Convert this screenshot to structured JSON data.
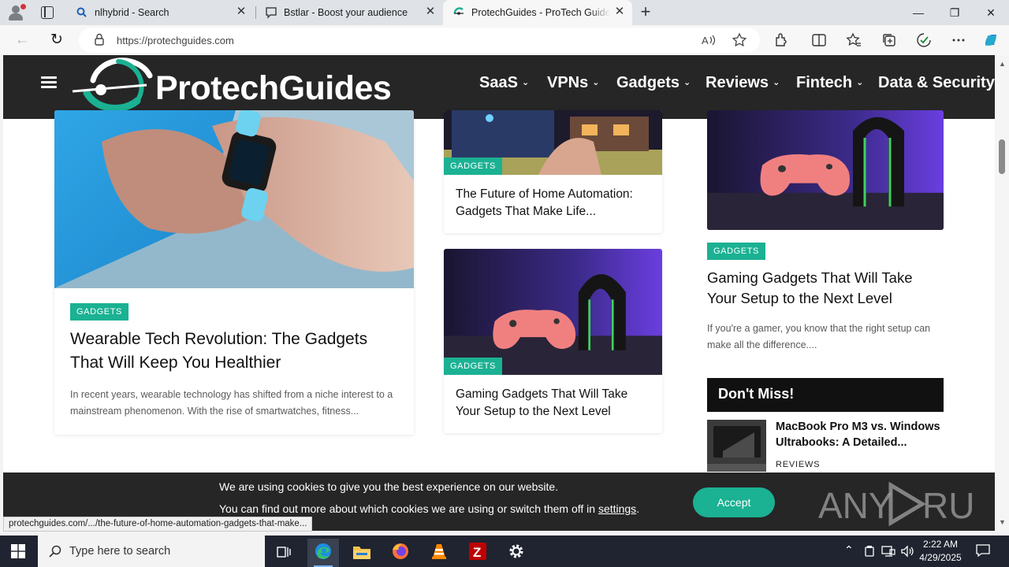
{
  "browser": {
    "tabs": [
      {
        "label": "nlhybrid - Search"
      },
      {
        "label": "Bstlar - Boost your audience"
      },
      {
        "label": "ProtechGuides - ProTech Guides:"
      }
    ],
    "tab_close": "✕",
    "new_tab": "+",
    "window": {
      "minimize": "—",
      "maximize": "❐",
      "close": "✕"
    },
    "url_host": "https://protechguides.com",
    "back": "←",
    "refresh": "↻"
  },
  "site": {
    "logo": "ProtechGuides",
    "nav": [
      "SaaS",
      "VPNs",
      "Gadgets",
      "Reviews",
      "Fintech",
      "Data & Security"
    ],
    "caret": "⌄"
  },
  "articles": {
    "wearable": {
      "badge": "GADGETS",
      "title": "Wearable Tech Revolution: The Gadgets That Will Keep You Healthier",
      "excerpt": "In recent years, wearable technology has shifted from a niche interest to a mainstream phenomenon. With the rise of smartwatches, fitness..."
    },
    "home_automation": {
      "badge": "GADGETS",
      "title": "The Future of Home Automation: Gadgets That Make Life..."
    },
    "gaming_mid": {
      "badge": "GADGETS",
      "title": "Gaming Gadgets That Will Take Your Setup to the Next Level"
    },
    "gaming_right": {
      "badge": "GADGETS",
      "title": "Gaming Gadgets That Will Take Your Setup to the Next Level",
      "excerpt": "If you're a gamer, you know that the right setup can make all the difference...."
    }
  },
  "dont_miss": {
    "heading": "Don't Miss!",
    "item_title": "MacBook Pro M3 vs. Windows Ultrabooks: A Detailed...",
    "item_category": "REVIEWS"
  },
  "cookie": {
    "line1": "We are using cookies to give you the best experience on our website.",
    "line2_prefix": "You can find out more about which cookies we are using or switch them off in ",
    "line2_link": "settings",
    "line2_suffix": ".",
    "accept": "Accept"
  },
  "watermark": "ANY RUN",
  "status_url": "protechguides.com/.../the-future-of-home-automation-gadgets-that-make...",
  "taskbar": {
    "search_placeholder": "Type here to search",
    "time": "2:22 AM",
    "date": "4/29/2025"
  },
  "colors": {
    "accent": "#1bb193",
    "header_bg": "#262626",
    "taskbar_bg": "#1f2430"
  }
}
